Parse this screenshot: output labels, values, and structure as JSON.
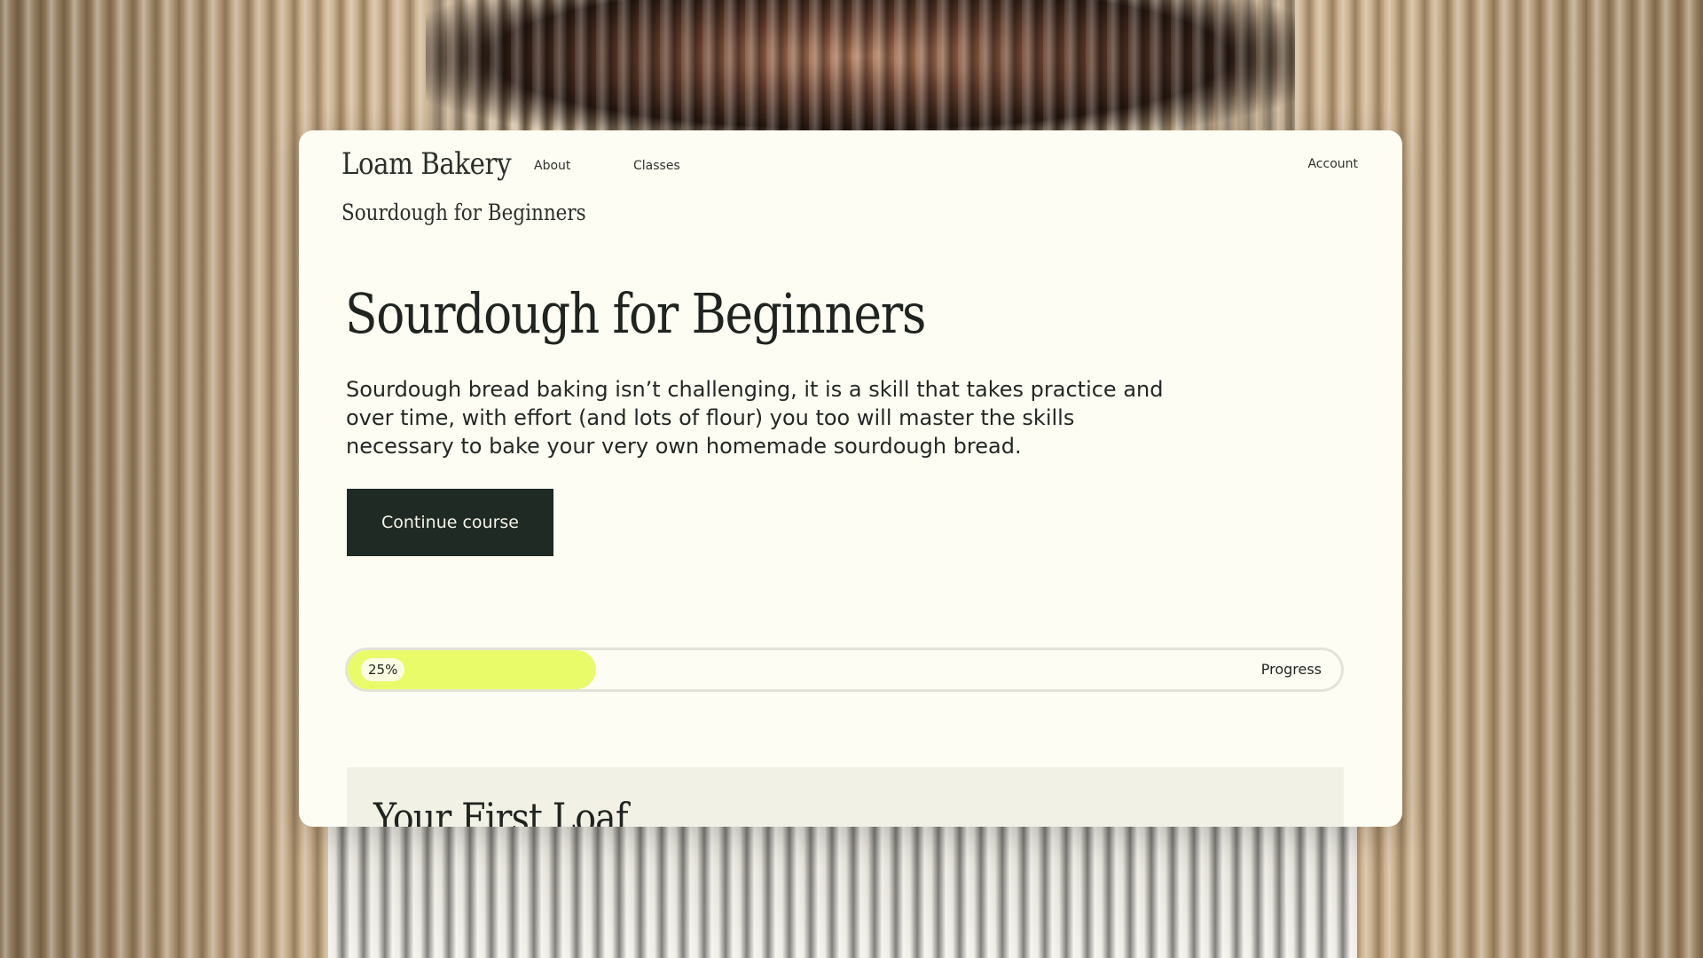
{
  "nav": {
    "brand": "Loam Bakery",
    "links": [
      "About",
      "Classes"
    ],
    "account": "Account"
  },
  "breadcrumb": "Sourdough for Beginners",
  "hero": {
    "title": "Sourdough for Beginners",
    "description": "Sourdough bread baking isn’t challenging, it is a skill that takes practice and over time, with effort (and lots of flour) you too will master the skills necessary to bake your very own homemade sourdough bread.",
    "cta_label": "Continue course"
  },
  "progress": {
    "value": 0.25,
    "percent_label": "25%",
    "label": "Progress",
    "fill_color": "#eafb6a"
  },
  "lesson": {
    "title": "Your First Loaf"
  },
  "colors": {
    "card_bg": "#fefdf3",
    "cta_bg": "#1f2a24",
    "accent": "#eafb6a"
  }
}
